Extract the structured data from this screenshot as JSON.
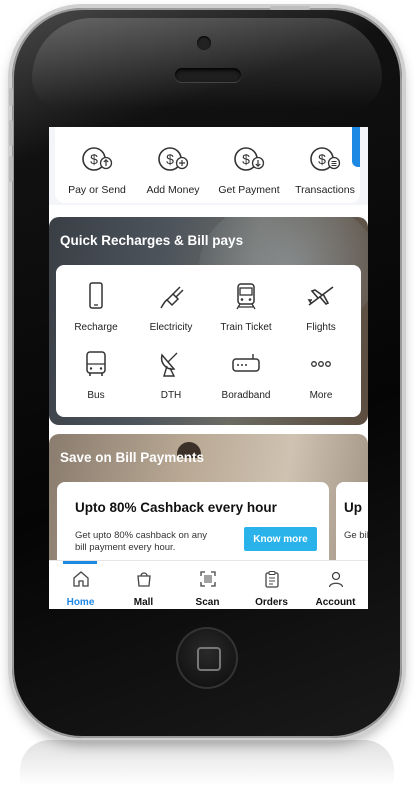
{
  "quick_actions": [
    {
      "label": "Pay or Send",
      "icon": "pay-send-icon"
    },
    {
      "label": "Add Money",
      "icon": "add-money-icon"
    },
    {
      "label": "Get Payment",
      "icon": "get-payment-icon"
    },
    {
      "label": "Transactions",
      "icon": "transactions-icon"
    }
  ],
  "recharge": {
    "title": "Quick Recharges & Bill pays",
    "items": [
      {
        "label": "Recharge",
        "icon": "mobile-icon"
      },
      {
        "label": "Electricity",
        "icon": "plug-icon"
      },
      {
        "label": "Train Ticket",
        "icon": "train-icon"
      },
      {
        "label": "Flights",
        "icon": "airplane-icon"
      },
      {
        "label": "Bus",
        "icon": "bus-icon"
      },
      {
        "label": "DTH",
        "icon": "satellite-dish-icon"
      },
      {
        "label": "Boradband",
        "icon": "router-icon"
      },
      {
        "label": "More",
        "icon": "more-icon"
      }
    ]
  },
  "bill": {
    "title": "Save on Bill Payments",
    "offer": {
      "title": "Upto 80% Cashback every hour",
      "desc": "Get upto 80% cashback on any bill payment every hour.",
      "button": "Know more"
    },
    "next_offer": {
      "title": "Up",
      "desc": "Ge bill"
    }
  },
  "nav": [
    {
      "label": "Home",
      "active": true
    },
    {
      "label": "Mall"
    },
    {
      "label": "Scan"
    },
    {
      "label": "Orders"
    },
    {
      "label": "Account"
    }
  ],
  "colors": {
    "accent": "#1e88e5",
    "button": "#29b3ea"
  }
}
